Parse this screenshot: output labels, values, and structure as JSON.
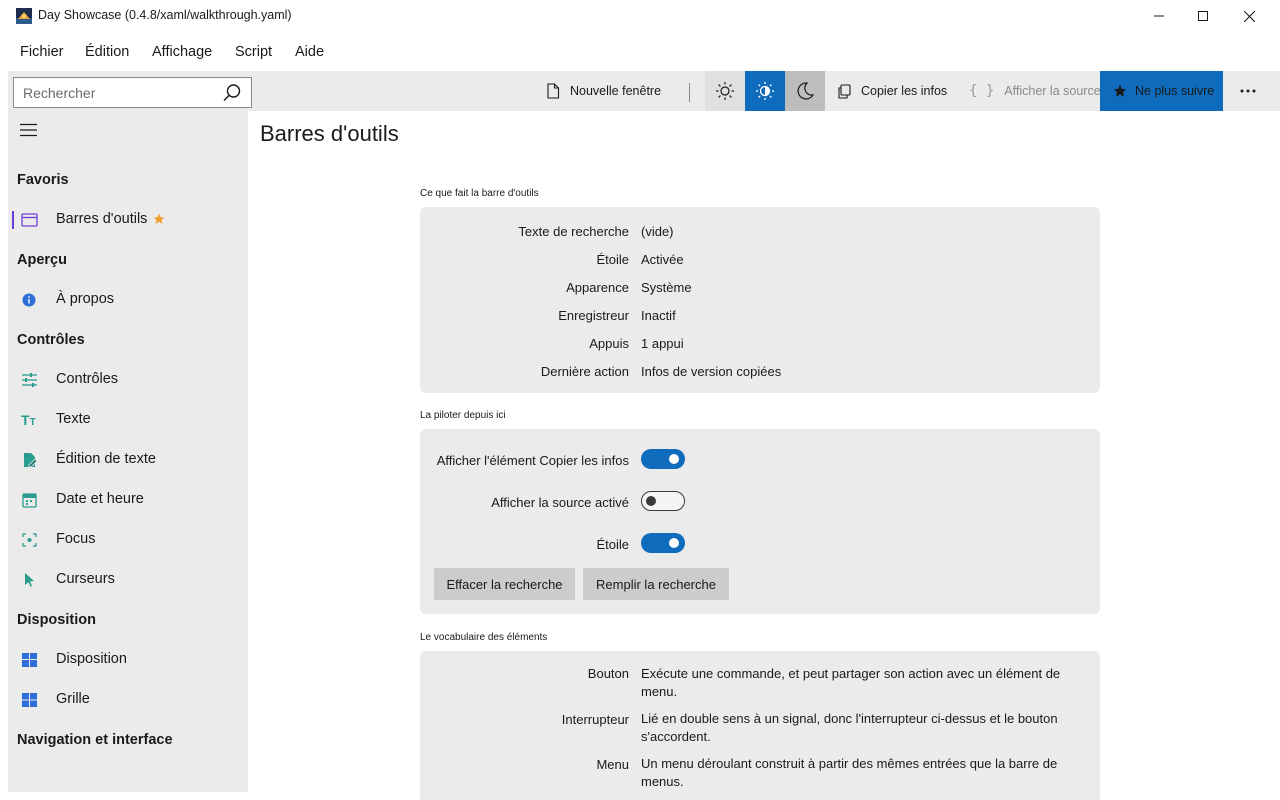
{
  "window": {
    "title": "Day Showcase (0.4.8/xaml/walkthrough.yaml)"
  },
  "menubar": {
    "items": [
      "Fichier",
      "Édition",
      "Affichage",
      "Script",
      "Aide"
    ]
  },
  "toolbar": {
    "search_placeholder": "Rechercher",
    "new_window_label": "Nouvelle fenêtre",
    "copy_info_label": "Copier les infos",
    "show_source_label": "Afficher la source",
    "unfollow_label": "Ne plus suivre",
    "theme_selected": "auto",
    "colors": {
      "accent": "#0f6cbd",
      "toolbar_bg": "#ebebeb",
      "selected_theme_bg": "#0f6cbd",
      "dark_theme_bg": "#bdbdbd"
    }
  },
  "sidebar": {
    "sections": [
      {
        "title": "Favoris",
        "items": [
          {
            "label": "Barres d'outils",
            "icon": "window-icon",
            "selected": true,
            "starred": true
          }
        ]
      },
      {
        "title": "Aperçu",
        "items": [
          {
            "label": "À propos",
            "icon": "info-icon"
          }
        ]
      },
      {
        "title": "Contrôles",
        "items": [
          {
            "label": "Contrôles",
            "icon": "sliders-icon"
          },
          {
            "label": "Texte",
            "icon": "text-size-icon"
          },
          {
            "label": "Édition de texte",
            "icon": "document-edit-icon"
          },
          {
            "label": "Date et heure",
            "icon": "calendar-icon"
          },
          {
            "label": "Focus",
            "icon": "focus-icon"
          },
          {
            "label": "Curseurs",
            "icon": "cursor-icon"
          }
        ]
      },
      {
        "title": "Disposition",
        "items": [
          {
            "label": "Disposition",
            "icon": "layout-icon"
          },
          {
            "label": "Grille",
            "icon": "grid-icon"
          }
        ]
      },
      {
        "title": "Navigation et interface",
        "items": []
      }
    ]
  },
  "main": {
    "title": "Barres d'outils",
    "what_it_does": {
      "label": "Ce que fait la barre d'outils",
      "rows": [
        {
          "key": "Texte de recherche",
          "value": "(vide)"
        },
        {
          "key": "Étoile",
          "value": "Activée"
        },
        {
          "key": "Apparence",
          "value": "Système"
        },
        {
          "key": "Enregistreur",
          "value": "Inactif"
        },
        {
          "key": "Appuis",
          "value": "1 appui"
        },
        {
          "key": "Dernière action",
          "value": "Infos de version copiées"
        }
      ]
    },
    "drive": {
      "label": "La piloter depuis ici",
      "toggles": [
        {
          "label": "Afficher l'élément Copier les infos",
          "on": true
        },
        {
          "label": "Afficher la source activé",
          "on": false
        },
        {
          "label": "Étoile",
          "on": true
        }
      ],
      "clear_search_label": "Effacer la recherche",
      "fill_search_label": "Remplir la recherche"
    },
    "vocabulary": {
      "label": "Le vocabulaire des éléments",
      "rows": [
        {
          "key": "Bouton",
          "value": "Exécute une commande, et peut partager son action avec un élément de menu."
        },
        {
          "key": "Interrupteur",
          "value": "Lié en double sens à un signal, donc l'interrupteur ci-dessus et le bouton s'accordent."
        },
        {
          "key": "Menu",
          "value": "Un menu déroulant construit à partir des mêmes entrées que la barre de menus."
        }
      ]
    }
  }
}
